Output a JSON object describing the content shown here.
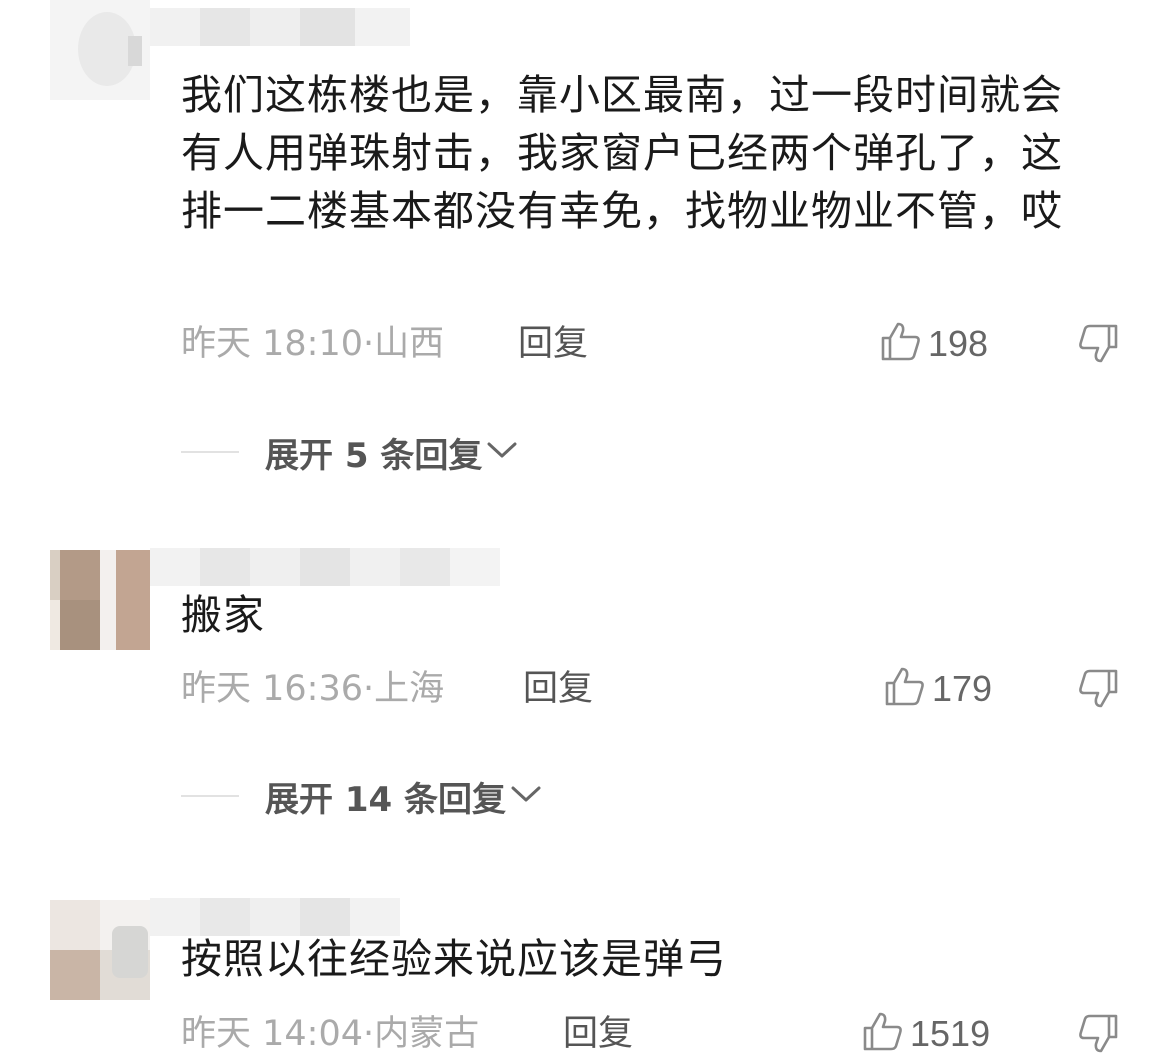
{
  "colors": {
    "text": "#1a1a1a",
    "meta": "#aaaaaa",
    "action": "#555555",
    "divider": "#e2e2e2"
  },
  "comments": [
    {
      "text": "我们这栋楼也是，靠小区最南，过一段时间就会有人用弹珠射击，我家窗户已经两个弹孔了，这排一二楼基本都没有幸免，找物业物业不管，哎",
      "time": "昨天 18:10",
      "location": "山西",
      "reply_label": "回复",
      "likes": "198",
      "expand_label": "展开 5 条回复"
    },
    {
      "text": "搬家",
      "time": "昨天 16:36",
      "location": "上海",
      "reply_label": "回复",
      "likes": "179",
      "expand_label": "展开 14 条回复"
    },
    {
      "text": "按照以往经验来说应该是弹弓",
      "time": "昨天 14:04",
      "location": "内蒙古",
      "reply_label": "回复",
      "likes": "1519"
    }
  ],
  "icons": {
    "like": "thumbs-up-icon",
    "dislike": "thumbs-down-icon",
    "expand": "chevron-down-icon"
  }
}
